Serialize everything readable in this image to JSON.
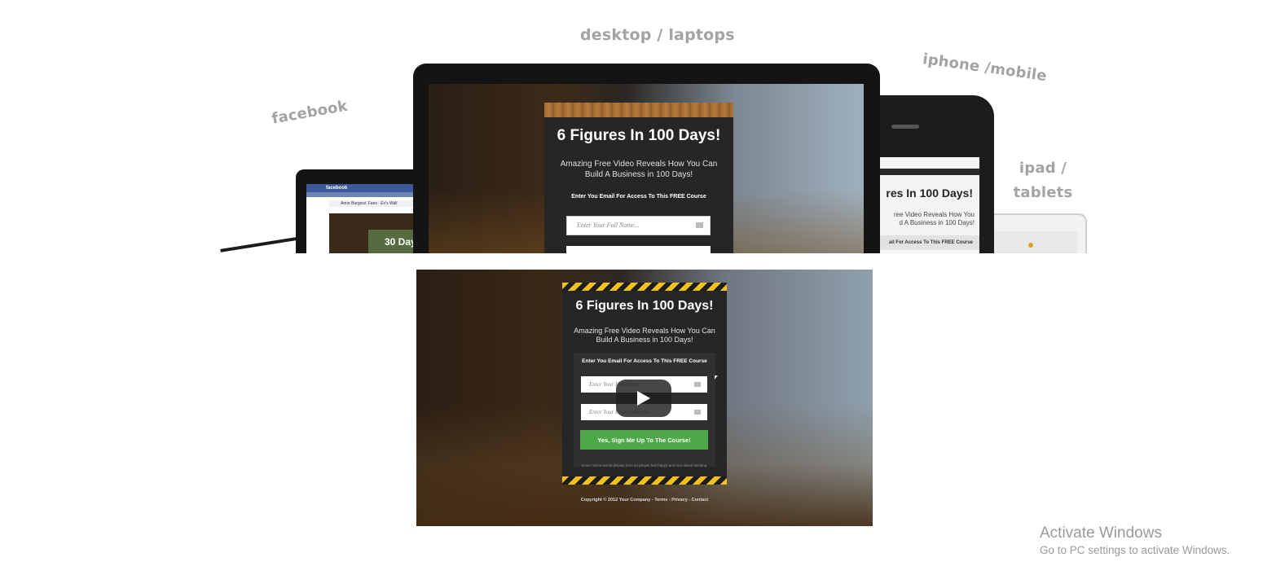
{
  "labels": {
    "desktop": "desktop / laptops",
    "facebook": "facebook",
    "iphone": "iphone /mobile",
    "ipad_line1": "ipad /",
    "ipad_line2": "tablets"
  },
  "desktop_preview": {
    "headline": "6 Figures In 100 Days!",
    "subhead": "Amazing Free Video Reveals How You Can Build A Business in 100 Days!",
    "form_caption": "Enter You Email For Access To This FREE Course",
    "name_placeholder": "Enter Your Full Name..."
  },
  "iphone_preview": {
    "headline": "res In 100 Days!",
    "subhead": "ree Video Reveals How You\nd A Business in 100 Days!",
    "form_caption": "ail For Access To This FREE Course"
  },
  "facebook_preview": {
    "brand": "facebook",
    "tab": "Anne Burgess' Fans · Ev's Wall",
    "card_text": "30 Day"
  },
  "video": {
    "headline": "6 Figures In 100 Days!",
    "subhead": "Amazing Free Video Reveals How You Can Build A Business in 100 Days!",
    "form_caption": "Enter You Email For Access To This FREE Course",
    "name_placeholder": "Enter Your Full Name...",
    "email_placeholder": "Enter Your Email Address...",
    "button_label": "Yes, Sign Me Up To The Course!",
    "small_print": "Scam notice would display here so people feel happy and nice about sending.",
    "copyright": "Copyright © 2012 Your Company - Terms - Privacy - Contact",
    "play_icon": "play-icon"
  },
  "watermark": {
    "title": "Activate Windows",
    "subtitle": "Go to PC settings to activate Windows."
  },
  "colors": {
    "button_green": "#4fa94a",
    "hazard_yellow": "#f2c21a",
    "facebook_blue": "#3b5998",
    "label_gray": "#a3a3a3"
  }
}
